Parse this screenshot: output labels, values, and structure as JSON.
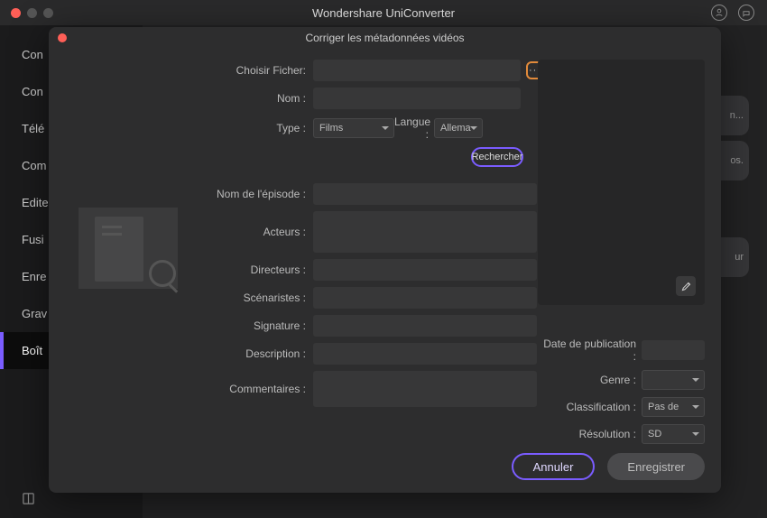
{
  "app": {
    "title": "Wondershare UniConverter"
  },
  "sidebar": {
    "items": [
      {
        "label": "Con"
      },
      {
        "label": "Con"
      },
      {
        "label": "Télé"
      },
      {
        "label": "Com"
      },
      {
        "label": "Edite"
      },
      {
        "label": "Fusi"
      },
      {
        "label": "Enre"
      },
      {
        "label": "Grav"
      },
      {
        "label": "Boît"
      }
    ]
  },
  "modal": {
    "title": "Corriger les métadonnées vidéos",
    "labels": {
      "choose_file": "Choisir Ficher:",
      "name": "Nom :",
      "type": "Type :",
      "language": "Langue :",
      "episode": "Nom de l'épisode :",
      "actors": "Acteurs :",
      "directors": "Directeurs :",
      "writers": "Scénaristes :",
      "signature": "Signature :",
      "description": "Description :",
      "comments": "Commentaires :",
      "pubdate": "Date de publication :",
      "genre": "Genre :",
      "classification": "Classification :",
      "resolution": "Résolution :"
    },
    "values": {
      "type": "Films",
      "language": "Allema",
      "classification": "Pas de",
      "resolution": "SD"
    },
    "buttons": {
      "browse": "···",
      "search": "Rechercher",
      "cancel": "Annuler",
      "save": "Enregistrer"
    }
  },
  "bg": {
    "t1": "n...",
    "t2": "os.",
    "t3": "ur"
  },
  "icons": {
    "profile": "profile-icon",
    "help": "help-icon",
    "edit": "edit-icon",
    "book": "book-icon"
  }
}
